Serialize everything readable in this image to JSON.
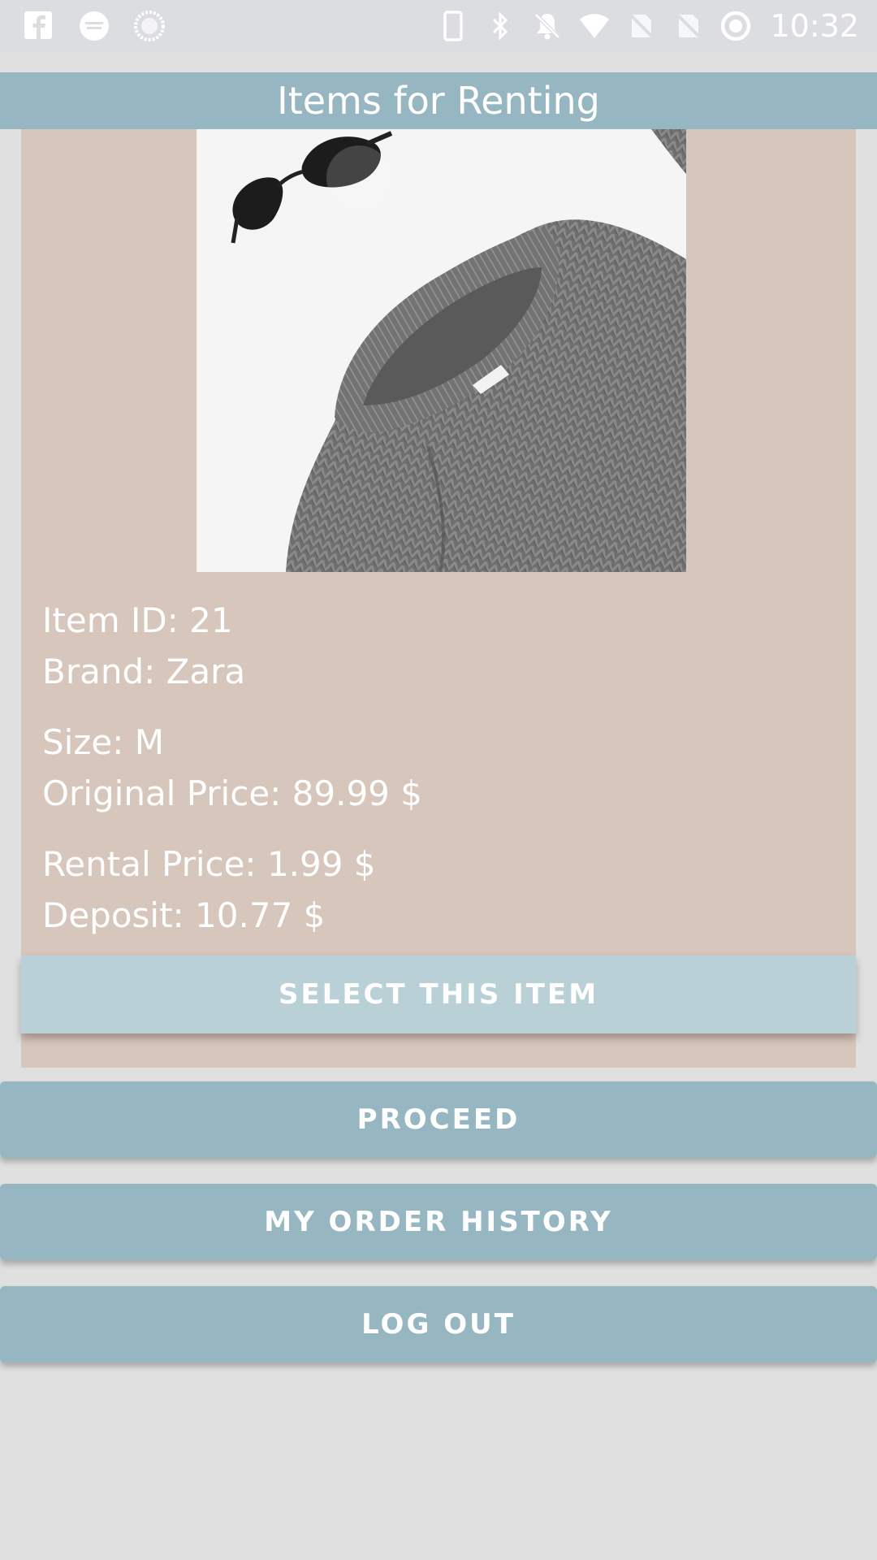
{
  "status_bar": {
    "time": "10:32",
    "left_icons": [
      "facebook-icon",
      "finish-line-icon",
      "sync-icon"
    ],
    "right_icons": [
      "phone-icon",
      "bluetooth-icon",
      "notifications-off-icon",
      "wifi-icon",
      "no-sim-icon",
      "no-sim-icon",
      "data-saver-icon"
    ]
  },
  "app_bar": {
    "title": "Items for Renting"
  },
  "item": {
    "id_line": "Item ID: 21",
    "brand_line": "Brand: Zara",
    "size_line": "Size: M",
    "original_price_line": "Original Price: 89.99 $",
    "rental_price_line": "Rental Price: 1.99 $",
    "deposit_line": "Deposit: 10.77 $",
    "select_label": "SELECT THIS ITEM"
  },
  "actions": {
    "proceed_label": "PROCEED",
    "history_label": "MY ORDER HISTORY",
    "logout_label": "LOG OUT"
  },
  "colors": {
    "accent": "#96b7c2",
    "card": "#d7c6bb",
    "select_button": "#b8d0d6",
    "background": "#e0e0e0"
  }
}
